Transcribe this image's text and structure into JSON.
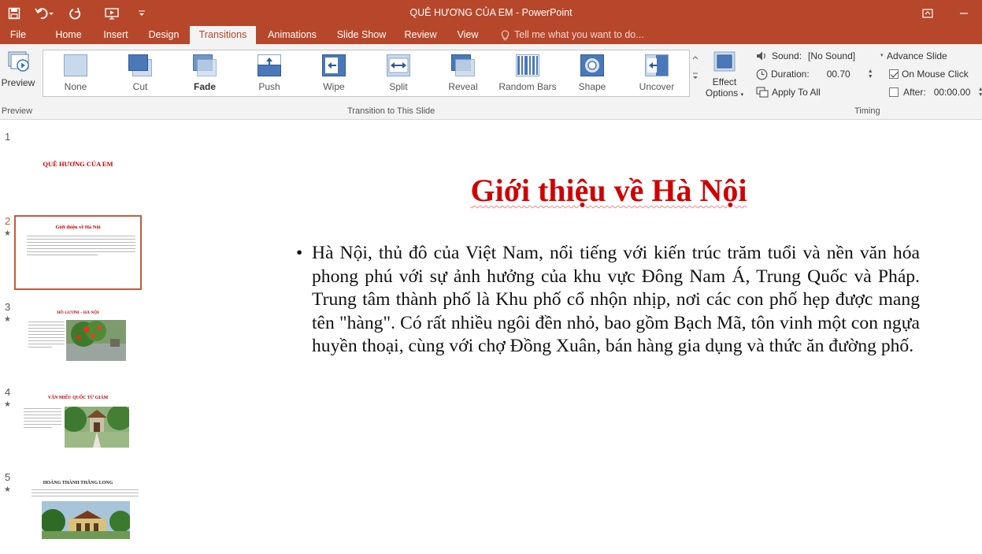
{
  "window": {
    "title": "QUÊ HƯƠNG CỦA EM  -  PowerPoint"
  },
  "tabs": [
    "File",
    "Home",
    "Insert",
    "Design",
    "Transitions",
    "Animations",
    "Slide Show",
    "Review",
    "View"
  ],
  "active_tab": "Transitions",
  "tell_me": "Tell me what you want to do...",
  "ribbon": {
    "preview_label": "Preview",
    "preview_group": "Preview",
    "transitions_group": "Transition to This Slide",
    "timing_group": "Timing",
    "transitions": [
      "None",
      "Cut",
      "Fade",
      "Push",
      "Wipe",
      "Split",
      "Reveal",
      "Random Bars",
      "Shape",
      "Uncover"
    ],
    "selected_transition": "Fade",
    "effect_options": [
      "Effect",
      "Options"
    ],
    "sound_label": "Sound:",
    "sound_value": "[No Sound]",
    "duration_label": "Duration:",
    "duration_value": "00.70",
    "apply_all": "Apply To All",
    "advance_title": "Advance Slide",
    "on_mouse_click": "On Mouse Click",
    "on_mouse_click_checked": true,
    "after_label": "After:",
    "after_value": "00:00.00",
    "after_checked": false
  },
  "thumbnails": [
    {
      "num": "1",
      "title": "QUÊ HƯƠNG CỦA EM",
      "star": ""
    },
    {
      "num": "2",
      "title": "Giới thiệu về Hà Nội",
      "star": "★"
    },
    {
      "num": "3",
      "title": "HỒ GƯƠM – HÀ NỘI",
      "star": "★"
    },
    {
      "num": "4",
      "title": "VĂN MIẾU QUỐC TỬ GIÁM",
      "star": "★"
    },
    {
      "num": "5",
      "title": "HOÀNG THÀNH THĂNG LONG",
      "star": "★"
    }
  ],
  "selected_slide": "2",
  "slide": {
    "title": "Giới thiệu về Hà Nội",
    "bullet": "•",
    "body": "Hà Nội, thủ đô của Việt Nam, nổi tiếng với kiến trúc trăm tuổi và nền văn hóa phong phú với sự ảnh hưởng của khu vực Đông Nam Á, Trung Quốc và Pháp. Trung tâm thành phố là Khu phố cổ nhộn nhịp, nơi các con phố hẹp được mang tên \"hàng\". Có rất nhiều ngôi đền nhỏ, bao gồm Bạch Mã, tôn vinh một con ngựa huyền thoại, cùng với chợ Đồng Xuân, bán hàng gia dụng và thức ăn đường phố."
  },
  "colors": {
    "brand": "#b7472a",
    "title_red": "#d00000",
    "thumb_border": "#c55a3b"
  }
}
